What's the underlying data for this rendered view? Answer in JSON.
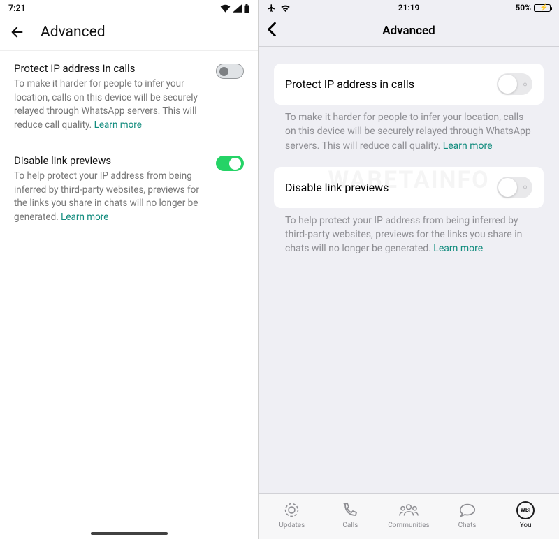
{
  "android": {
    "status_time": "7:21",
    "header_title": "Advanced",
    "settings": [
      {
        "title": "Protect IP address in calls",
        "description": "To make it harder for people to infer your location, calls on this device will be securely relayed through WhatsApp servers. This will reduce call quality. ",
        "learn_more": "Learn more",
        "enabled": false
      },
      {
        "title": "Disable link previews",
        "description": "To help protect your IP address from being inferred by third-party websites, previews for the links you share in chats will no longer be generated. ",
        "learn_more": "Learn more",
        "enabled": true
      }
    ]
  },
  "ios": {
    "status_time": "21:19",
    "battery_pct": "50%",
    "header_title": "Advanced",
    "settings": [
      {
        "title": "Protect IP address in calls",
        "description": "To make it harder for people to infer your location, calls on this device will be securely relayed through WhatsApp servers. This will reduce call quality. ",
        "learn_more": "Learn more",
        "enabled": false
      },
      {
        "title": "Disable link previews",
        "description": "To help protect your IP address from being inferred by third-party websites, previews for the links you share in chats will no longer be generated. ",
        "learn_more": "Learn more",
        "enabled": false
      }
    ],
    "tabs": [
      {
        "label": "Updates"
      },
      {
        "label": "Calls"
      },
      {
        "label": "Communities"
      },
      {
        "label": "Chats"
      },
      {
        "label": "You"
      }
    ]
  }
}
